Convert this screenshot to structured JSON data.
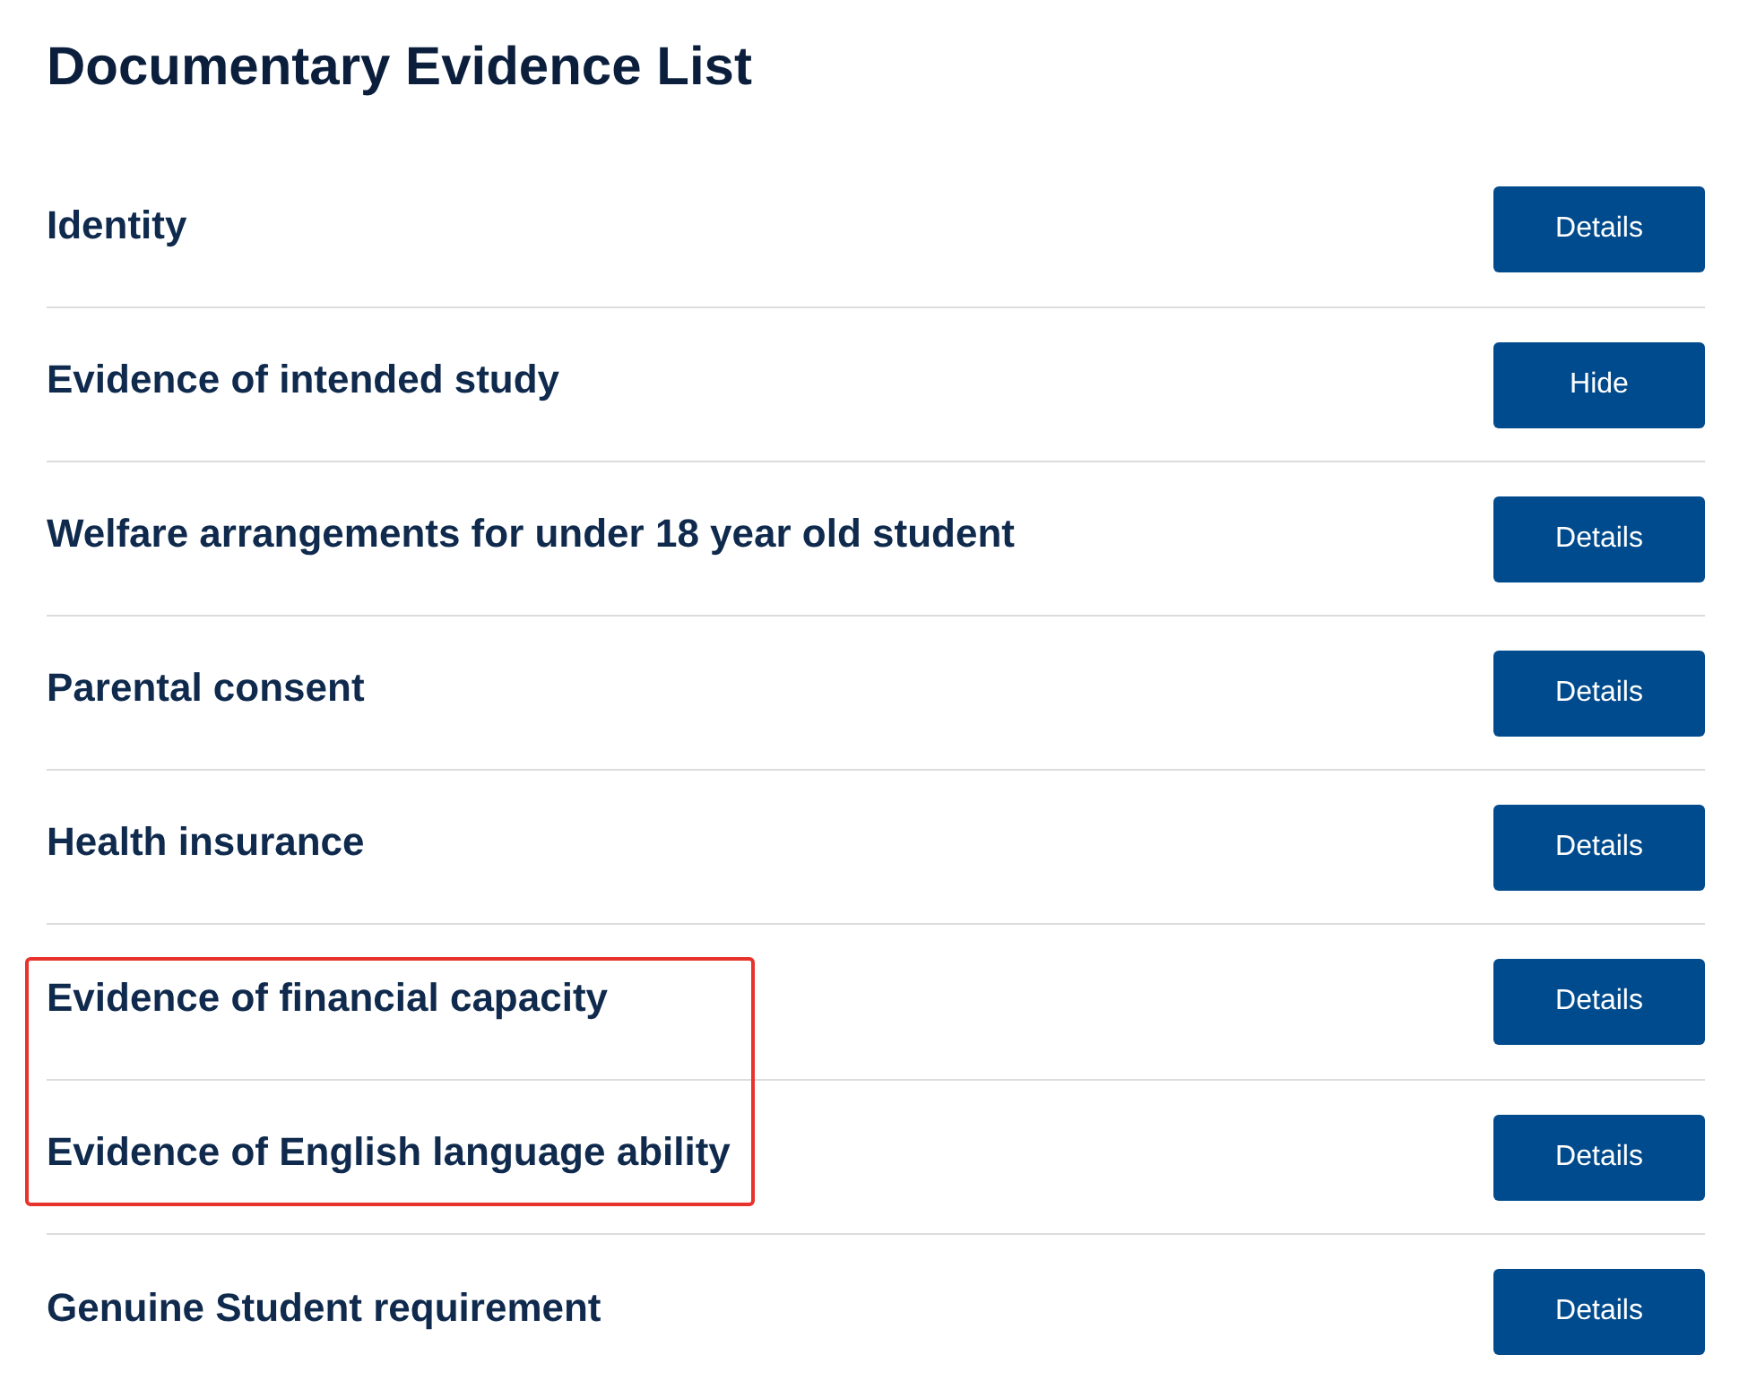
{
  "title": "Documentary Evidence List",
  "rows": [
    {
      "label": "Identity",
      "button": "Details",
      "highlighted": false
    },
    {
      "label": "Evidence of intended study",
      "button": "Hide",
      "highlighted": false
    },
    {
      "label": "Welfare arrangements for under 18 year old student",
      "button": "Details",
      "highlighted": false
    },
    {
      "label": "Parental consent",
      "button": "Details",
      "highlighted": false
    },
    {
      "label": "Health insurance",
      "button": "Details",
      "highlighted": false
    },
    {
      "label": "Evidence of financial capacity",
      "button": "Details",
      "highlighted": true
    },
    {
      "label": "Evidence of English language ability",
      "button": "Details",
      "highlighted": true
    },
    {
      "label": "Genuine Student requirement",
      "button": "Details",
      "highlighted": false
    }
  ]
}
